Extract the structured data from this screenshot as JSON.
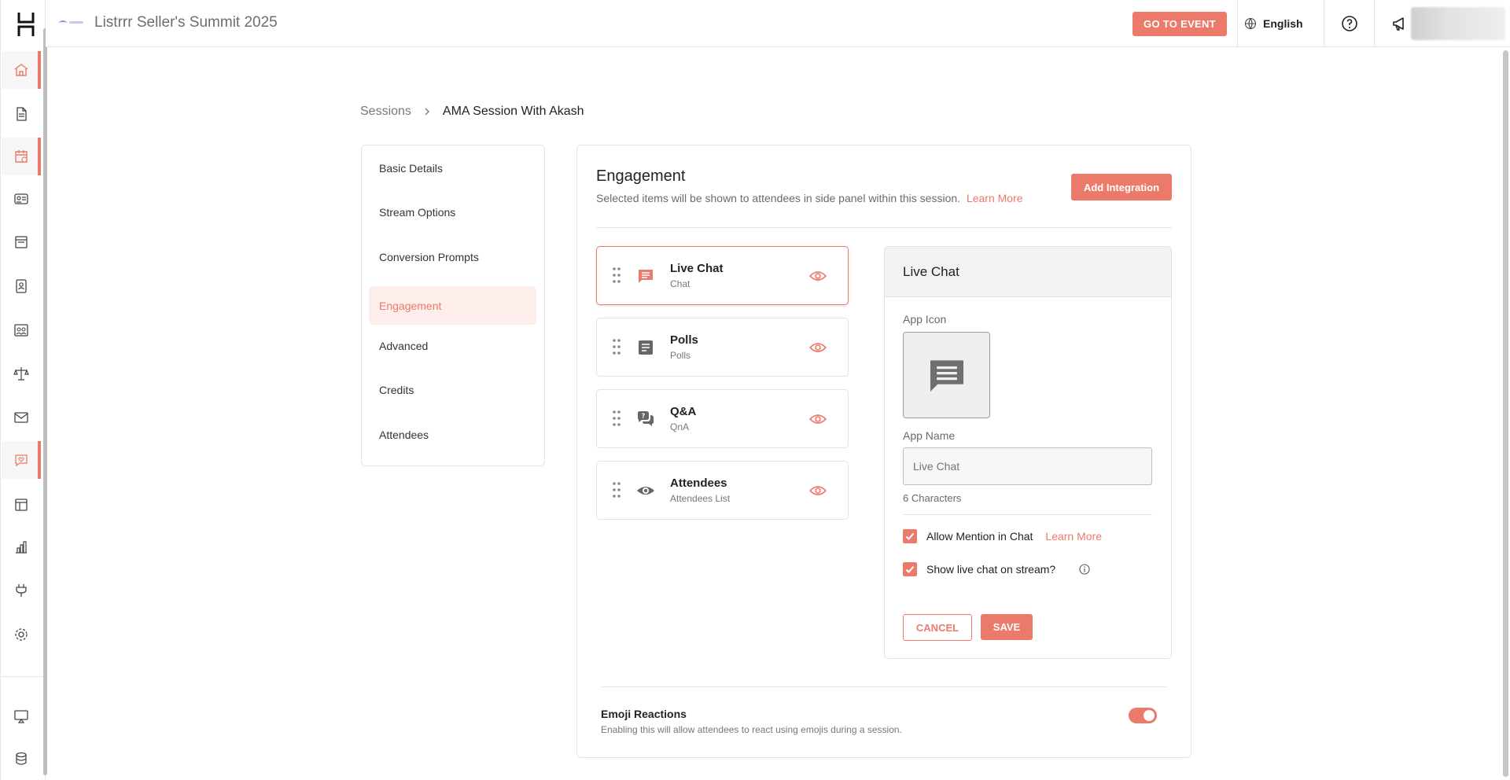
{
  "header": {
    "event_title": "Listrrr Seller's Summit 2025",
    "go_to_event": "GO TO EVENT",
    "language": "English"
  },
  "sidebar": {
    "icons": [
      "home-icon",
      "document-icon",
      "calendar-icon",
      "id-card-icon",
      "layout-icon",
      "badge-icon",
      "people-icon",
      "network-icon",
      "mail-icon",
      "heart-chat-icon",
      "template-icon",
      "analytics-icon",
      "plug-icon",
      "gear-icon",
      "cast-icon",
      "database-icon"
    ]
  },
  "breadcrumb": {
    "parent": "Sessions",
    "current": "AMA Session With Akash"
  },
  "settings_nav": {
    "items": [
      {
        "label": "Basic Details"
      },
      {
        "label": "Stream Options"
      },
      {
        "label": "Conversion Prompts"
      },
      {
        "label": "Engagement",
        "active": true
      },
      {
        "label": "Advanced"
      },
      {
        "label": "Credits"
      },
      {
        "label": "Attendees"
      }
    ]
  },
  "engagement": {
    "title": "Engagement",
    "description": "Selected items will be shown to attendees in side panel within this session.",
    "learn_more": "Learn More",
    "add_integration": "Add Integration",
    "apps": [
      {
        "name": "Live Chat",
        "sub": "Chat",
        "icon": "chat-icon",
        "selected": true
      },
      {
        "name": "Polls",
        "sub": "Polls",
        "icon": "poll-icon"
      },
      {
        "name": "Q&A",
        "sub": "QnA",
        "icon": "qna-icon"
      },
      {
        "name": "Attendees",
        "sub": "Attendees List",
        "icon": "eye-icon"
      }
    ],
    "detail": {
      "title": "Live Chat",
      "app_icon_label": "App Icon",
      "app_name_label": "App Name",
      "app_name_placeholder": "Live Chat",
      "char_count": "6 Characters",
      "allow_mention": "Allow Mention in Chat",
      "allow_mention_learn": "Learn More",
      "show_on_stream": "Show live chat on stream?",
      "cancel": "CANCEL",
      "save": "SAVE"
    },
    "emoji": {
      "title": "Emoji Reactions",
      "description": "Enabling this will allow attendees to react using emojis during a session.",
      "enabled": true
    }
  },
  "colors": {
    "accent": "#ec7a6a"
  }
}
